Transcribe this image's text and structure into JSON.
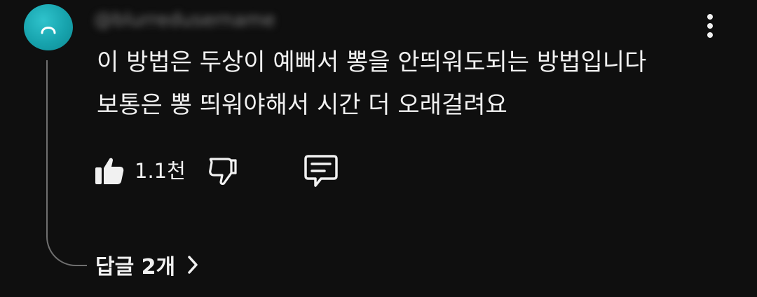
{
  "comment": {
    "author": "@blurredusername",
    "text_lines": [
      "이 방법은 두상이 예뻐서 뽕을 안띄워도되는 방법입니다",
      "보통은 뽕 띄워야해서 시간 더 오래걸려요"
    ]
  },
  "actions": {
    "like_icon": "thumbs-up-filled-icon",
    "like_count": "1.1천",
    "dislike_icon": "thumbs-down-outline-icon",
    "reply_icon": "comment-bubble-icon",
    "more_icon": "vertical-ellipsis-icon"
  },
  "replies": {
    "label": "답글 2개",
    "icon": "chevron-right-icon"
  },
  "colors": {
    "background": "#0f0f0f",
    "text": "#f1f1f1",
    "avatar": "#17a3ad",
    "thread_line": "#6f6f6f"
  }
}
